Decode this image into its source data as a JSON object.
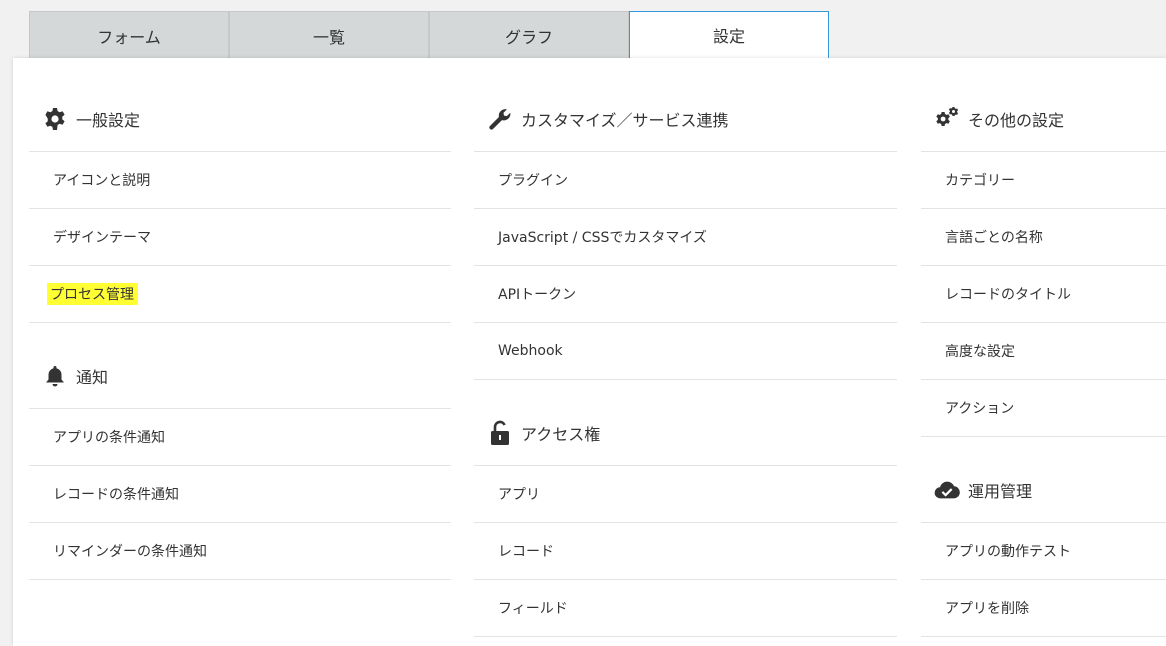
{
  "tabs": [
    "フォーム",
    "一覧",
    "グラフ",
    "設定"
  ],
  "general": {
    "title": "一般設定",
    "items": [
      "アイコンと説明",
      "デザインテーマ",
      "プロセス管理"
    ]
  },
  "notify": {
    "title": "通知",
    "items": [
      "アプリの条件通知",
      "レコードの条件通知",
      "リマインダーの条件通知"
    ]
  },
  "custom": {
    "title": "カスタマイズ／サービス連携",
    "items": [
      "プラグイン",
      "JavaScript / CSSでカスタマイズ",
      "APIトークン",
      "Webhook"
    ]
  },
  "access": {
    "title": "アクセス権",
    "items": [
      "アプリ",
      "レコード",
      "フィールド"
    ]
  },
  "other": {
    "title": "その他の設定",
    "items": [
      "カテゴリー",
      "言語ごとの名称",
      "レコードのタイトル",
      "高度な設定",
      "アクション"
    ]
  },
  "ops": {
    "title": "運用管理",
    "items": [
      "アプリの動作テスト",
      "アプリを削除"
    ]
  },
  "colors": {
    "highlight": "#ffff33",
    "active_border": "#3498db",
    "tab_bg": "#d4d8d9"
  }
}
